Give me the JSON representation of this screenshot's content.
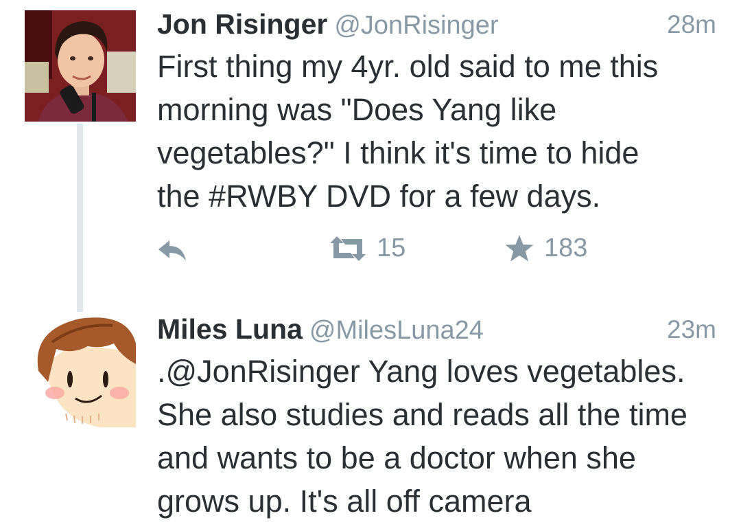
{
  "tweets": [
    {
      "name": "Jon Risinger",
      "handle": "@JonRisinger",
      "time": "28m",
      "text_lines": [
        "First thing my 4yr. old said to me this",
        "morning was \"Does Yang like",
        "vegetables?\" I think it's time to hide",
        "the #RWBY DVD for a few days."
      ],
      "retweets": "15",
      "favorites": "183"
    },
    {
      "name": "Miles Luna",
      "handle": "@MilesLuna24",
      "time": "23m",
      "text_lines": [
        ".@JonRisinger Yang loves vegetables.",
        "She also studies and reads all the time",
        "and wants to be a doctor when she",
        "grows up. It's all off camera"
      ]
    }
  ],
  "icons": {
    "reply": "reply-icon",
    "retweet": "retweet-icon",
    "favorite": "star-icon"
  },
  "colors": {
    "text": "#292f33",
    "muted": "#8899a6",
    "thread_line": "#e1e8ed"
  }
}
